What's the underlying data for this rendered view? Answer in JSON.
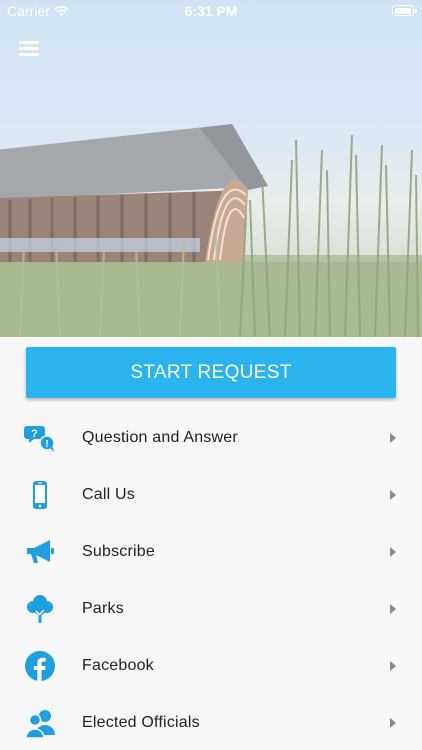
{
  "status_bar": {
    "carrier": "Carrier",
    "time": "6:31 PM",
    "battery_level": 1.0
  },
  "header": {
    "menu_icon": "hamburger-menu-icon",
    "hero_image": "covered bridge in tall grass"
  },
  "start_request": {
    "label": "START REQUEST",
    "color": "#2ab3ec"
  },
  "menu": {
    "accent_color": "#1f9fe0",
    "items": [
      {
        "label": "Question and Answer",
        "icon": "question-bubbles-icon"
      },
      {
        "label": "Call Us",
        "icon": "phone-icon"
      },
      {
        "label": "Subscribe",
        "icon": "megaphone-icon"
      },
      {
        "label": "Parks",
        "icon": "tree-icon"
      },
      {
        "label": "Facebook",
        "icon": "facebook-icon"
      },
      {
        "label": "Elected Officials",
        "icon": "officials-icon"
      }
    ]
  }
}
